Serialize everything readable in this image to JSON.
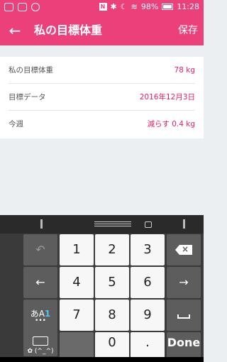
{
  "status_bar": {
    "battery": "98%",
    "time": "11:28",
    "nfc_badge": "N",
    "bluetooth_glyph": "✱",
    "moon_glyph": "☾",
    "wifi_glyph": "≋"
  },
  "app_bar": {
    "back_icon": "arrow-left",
    "back_glyph": "←",
    "title": "私の目標体重",
    "save_label": "保存",
    "color": "#ec407a"
  },
  "rows": [
    {
      "label": "私の目標体重",
      "value": "78 kg"
    },
    {
      "label": "目標データ",
      "value": "2016年12月3日"
    },
    {
      "label": "今週",
      "value": "減らす 0.4 kg"
    }
  ],
  "keyboard": {
    "digits": [
      "1",
      "2",
      "3",
      "4",
      "5",
      "6",
      "7",
      "8",
      "9",
      "0",
      "."
    ],
    "mode_label_a": "あA",
    "mode_label_1": "1",
    "mode_dots": "•••",
    "emoji_label": "(^_^)",
    "emoji_prefix": "✿",
    "undo_glyph": "↶",
    "left_glyph": "←",
    "right_glyph": "→",
    "done_label": "Done",
    "backspace_glyph": "×"
  }
}
